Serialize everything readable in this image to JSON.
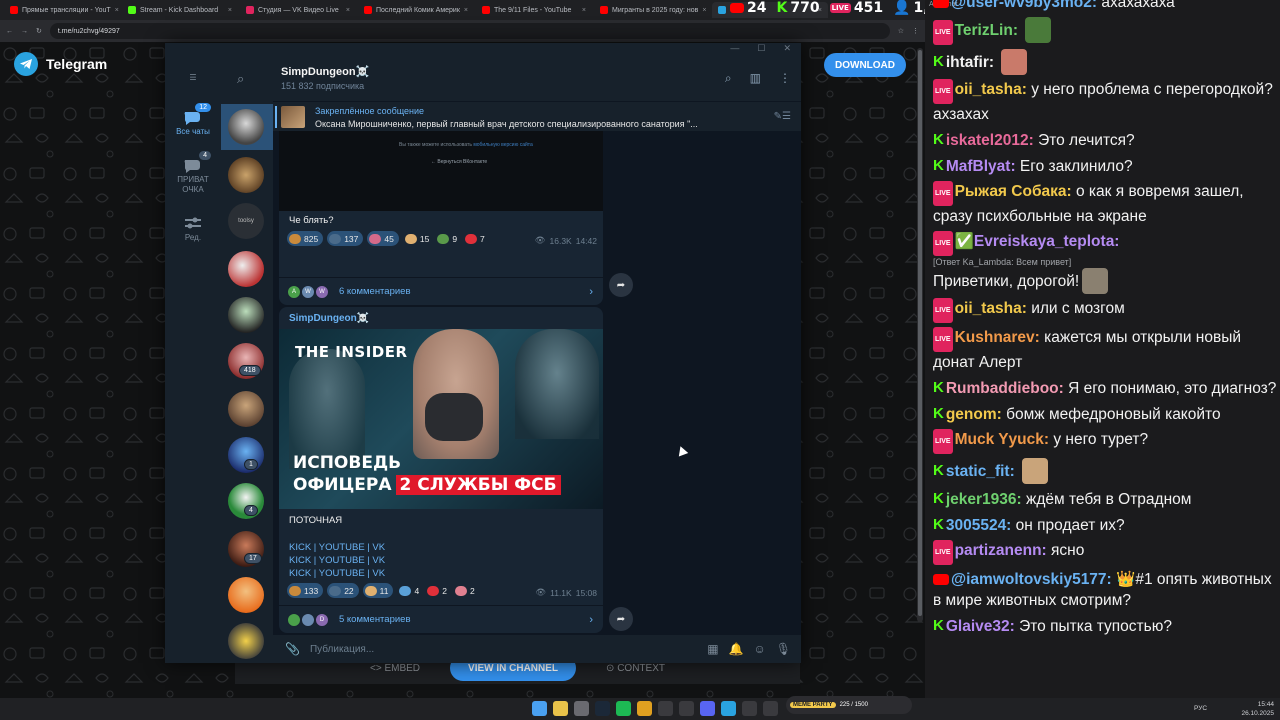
{
  "browser": {
    "tabs": [
      {
        "title": "Прямые трансляции - YouT",
        "color": "#ff0000"
      },
      {
        "title": "Stream - Kick Dashboard",
        "color": "#53fc18"
      },
      {
        "title": "Студия — VK Видео Live",
        "color": "#e0245e"
      },
      {
        "title": "Последний Комик Америк",
        "color": "#ff0000"
      },
      {
        "title": "The 9/11 Files - YouTube",
        "color": "#ff0000"
      },
      {
        "title": "Мигранты в 2025 году: нов",
        "color": "#ff0000"
      },
      {
        "title": "Tele",
        "color": "#2aa3e0"
      }
    ],
    "url": "t.me/ru2chvg/49297"
  },
  "stream_counters": {
    "youtube": "24",
    "kick": "770",
    "vk": "451",
    "viewers": "1,245"
  },
  "tg_page": {
    "brand": "Telegram",
    "download": "DOWNLOAD",
    "embed": "EMBED",
    "view_in_channel": "VIEW IN CHANNEL",
    "context": "CONTEXT"
  },
  "tg": {
    "nav": {
      "all_chats": "Все чаты",
      "all_chats_badge": "12",
      "private": "ПРИВАТ\nОЧКА",
      "private_badge": "4",
      "edit": "Ред."
    },
    "chat_badges": [
      "418",
      "1",
      "4",
      "17"
    ],
    "channel_title": "SimpDungeon☠️",
    "subscribers": "151 832 подписчика",
    "pinned_label": "Закреплённое сообщение",
    "pinned_text": "Оксана Мирошниченко, первый главный врач детского специализированного  санатория \"...",
    "composer_placeholder": "Публикация..."
  },
  "messages": [
    {
      "image_text1": "Вы также можете использовать",
      "image_link": "мобильную версию сайта",
      "image_text2": "← Вернуться ВКонтакте",
      "text": "Че блять?",
      "reactions": [
        {
          "count": "825",
          "color": "#c98a3c"
        },
        {
          "count": "137",
          "color": "#4a6b8a"
        },
        {
          "count": "45",
          "color": "#d46a8a"
        },
        {
          "count": "15",
          "color": "#e0b070"
        },
        {
          "count": "9",
          "color": "#5a9a4a"
        },
        {
          "count": "7",
          "color": "#e0303a"
        }
      ],
      "views": "16.3K",
      "time": "14:42",
      "comment_avatars": [
        "A",
        "W",
        "W"
      ],
      "comments": "6 комментариев"
    },
    {
      "sender": "SimpDungeon☠️",
      "thumb_brand": "THE INSIDER",
      "thumb_line1": "ИСПОВЕДЬ",
      "thumb_line2": "ОФИЦЕРА",
      "thumb_line2_box": "2 СЛУЖБЫ ФСБ",
      "text": "ПОТОЧНАЯ",
      "link_lines": [
        "KICK | YOUTUBE | VK",
        "KICK | YOUTUBE | VK",
        "KICK | YOUTUBE | VK"
      ],
      "reactions": [
        {
          "count": "133",
          "color": "#c98a3c"
        },
        {
          "count": "22",
          "color": "#4a6b8a"
        },
        {
          "count": "11",
          "color": "#e0b070"
        },
        {
          "count": "4",
          "color": "#5aa0d8"
        },
        {
          "count": "2",
          "color": "#e0303a"
        },
        {
          "count": "2",
          "color": "#e08090"
        }
      ],
      "views": "11.1K",
      "time": "15:08",
      "comment_avatars": [
        "",
        "",
        "D"
      ],
      "comments": "5 комментариев"
    }
  ],
  "chatpanel": {
    "title": "AxelChat",
    "messages": [
      {
        "platform": "yt",
        "name": "@user-wv9by3mo2:",
        "color": "#6ab2f2",
        "text": "ахахахаха"
      },
      {
        "platform": "live",
        "name": "TerizLin:",
        "color": "#6fd06f",
        "text": "",
        "emote": "#4a7a3a"
      },
      {
        "platform": "kick",
        "name": "ihtafir:",
        "color": "#f2f2f2",
        "text": "",
        "emote": "#c97a6a"
      },
      {
        "platform": "live",
        "name": "oii_tasha:",
        "color": "#f2c94c",
        "text": "у него проблема с перегородкой? ахзахах"
      },
      {
        "platform": "kick",
        "name": "iskatel2012:",
        "color": "#e86a9a",
        "text": "Это лечится?"
      },
      {
        "platform": "kick",
        "name": "MafBlyat:",
        "color": "#b58bf2",
        "text": "Его заклинило?"
      },
      {
        "platform": "live",
        "name": "Рыжая Собака:",
        "color": "#f2c94c",
        "text": "о как я вовремя зашел, сразу психбольные на экране"
      },
      {
        "platform": "live",
        "name": "✅Evreiskaya_teplota:",
        "color": "#b58bf2",
        "reply": "[Ответ Ka_Lambda: Всем привет]",
        "text": "Приветики, дорогой!",
        "emote": "#8a8070"
      },
      {
        "platform": "live",
        "name": "oii_tasha:",
        "color": "#f2c94c",
        "text": "или с мозгом"
      },
      {
        "platform": "live",
        "name": "Kushnarev:",
        "color": "#f29a4a",
        "text": "кажется мы открыли новый донат Алерт"
      },
      {
        "platform": "kick",
        "name": "Rumbaddieboo:",
        "color": "#f29ab2",
        "text": "Я его понимаю, это диагноз?"
      },
      {
        "platform": "kick",
        "name": "genom:",
        "color": "#f2c94c",
        "text": "бомж мефедроновый какойто"
      },
      {
        "platform": "live",
        "name": "Muck Yyuck:",
        "color": "#f29a4a",
        "text": "у него турет?"
      },
      {
        "platform": "kick",
        "name": "static_fit:",
        "color": "#6ab2f2",
        "text": "",
        "emote": "#c9a47a"
      },
      {
        "platform": "kick",
        "name": "jeker1936:",
        "color": "#6fd06f",
        "text": "ждём тебя в Отрадном"
      },
      {
        "platform": "kick",
        "name": "3005524:",
        "color": "#6ab2f2",
        "text": "он продает их?"
      },
      {
        "platform": "live",
        "name": "partizanenn:",
        "color": "#b58bf2",
        "text": "ясно"
      },
      {
        "platform": "yt",
        "name": "@iamwoltovskiy5177:",
        "color": "#6ab2f2",
        "text": "👑#1 опять животных в мире животных смотрим?"
      },
      {
        "platform": "kick",
        "name": "Glaive32:",
        "color": "#b58bf2",
        "text": "Это пытка тупостью?"
      }
    ]
  },
  "taskbar": {
    "meme_label": "MEME PARTY",
    "meme_counter": "225 / 1500",
    "lang": "РУС",
    "time": "15:44",
    "date": "26.10.2025"
  }
}
